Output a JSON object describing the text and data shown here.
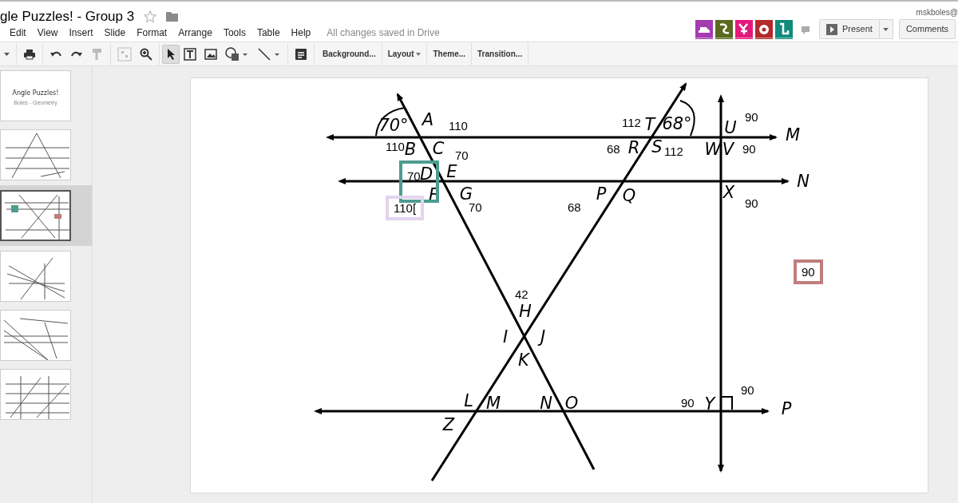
{
  "document": {
    "title": "gle Puzzles! - Group 3",
    "starred": false
  },
  "menu": [
    "Edit",
    "View",
    "Insert",
    "Slide",
    "Format",
    "Arrange",
    "Tools",
    "Table",
    "Help"
  ],
  "save_status": "All changes saved in Drive",
  "user": "mskboles@",
  "addons": [
    {
      "color": "#a53bb1"
    },
    {
      "color": "#5b6a1f"
    },
    {
      "color": "#e3197b"
    },
    {
      "color": "#b32a2c"
    },
    {
      "color": "#118a7c"
    }
  ],
  "present_button": "Present",
  "comments_button": "Comments",
  "toolbar": [
    {
      "kind": "caret",
      "selected": false
    },
    {
      "kind": "print",
      "selected": false
    },
    {
      "kind": "undo",
      "selected": false
    },
    {
      "kind": "redo",
      "selected": false
    },
    {
      "kind": "paint",
      "selected": false
    },
    {
      "kind": "fit",
      "selected": false
    },
    {
      "kind": "zoom",
      "selected": false
    },
    {
      "kind": "pointer",
      "selected": true
    },
    {
      "kind": "textbox",
      "selected": false
    },
    {
      "kind": "image",
      "selected": false
    },
    {
      "kind": "shape",
      "selected": false
    },
    {
      "kind": "line",
      "selected": false
    },
    {
      "kind": "notes",
      "selected": false
    }
  ],
  "toolbar_buttons": [
    {
      "label": "Background...",
      "dropdown": false
    },
    {
      "label": "Layout",
      "dropdown": true
    },
    {
      "label": "Theme...",
      "dropdown": false
    },
    {
      "label": "Transition...",
      "dropdown": false
    }
  ],
  "slides": [
    {
      "selected": false,
      "title": "Angle Puzzles!",
      "subtitle": "Boles - Geometry"
    },
    {
      "selected": false
    },
    {
      "selected": true
    },
    {
      "selected": false
    },
    {
      "selected": false
    },
    {
      "selected": false
    }
  ],
  "slide": {
    "diagram_labels": [
      "A",
      "B",
      "C",
      "D",
      "E",
      "F",
      "G",
      "T",
      "R",
      "S",
      "U",
      "W",
      "V",
      "P",
      "Q",
      "X",
      "H",
      "I",
      "J",
      "K",
      "L",
      "M",
      "N",
      "O",
      "Z",
      "Y",
      "70°",
      "68°",
      "M",
      "N",
      "P"
    ],
    "angle_values": [
      {
        "text": "110"
      },
      {
        "text": "112"
      },
      {
        "text": "90"
      },
      {
        "text": "110"
      },
      {
        "text": "70"
      },
      {
        "text": "68"
      },
      {
        "text": "112"
      },
      {
        "text": "90"
      },
      {
        "text": "70"
      },
      {
        "text": "110[",
        "color": "#e4d4ee"
      },
      {
        "text": "70"
      },
      {
        "text": "68"
      },
      {
        "text": "90"
      },
      {
        "text": "90",
        "color": "#c07e7c"
      },
      {
        "text": "42"
      },
      {
        "text": "90"
      },
      {
        "text": "90"
      }
    ],
    "highlight_boxes": [
      {
        "color": "#4d9c8f"
      }
    ]
  }
}
